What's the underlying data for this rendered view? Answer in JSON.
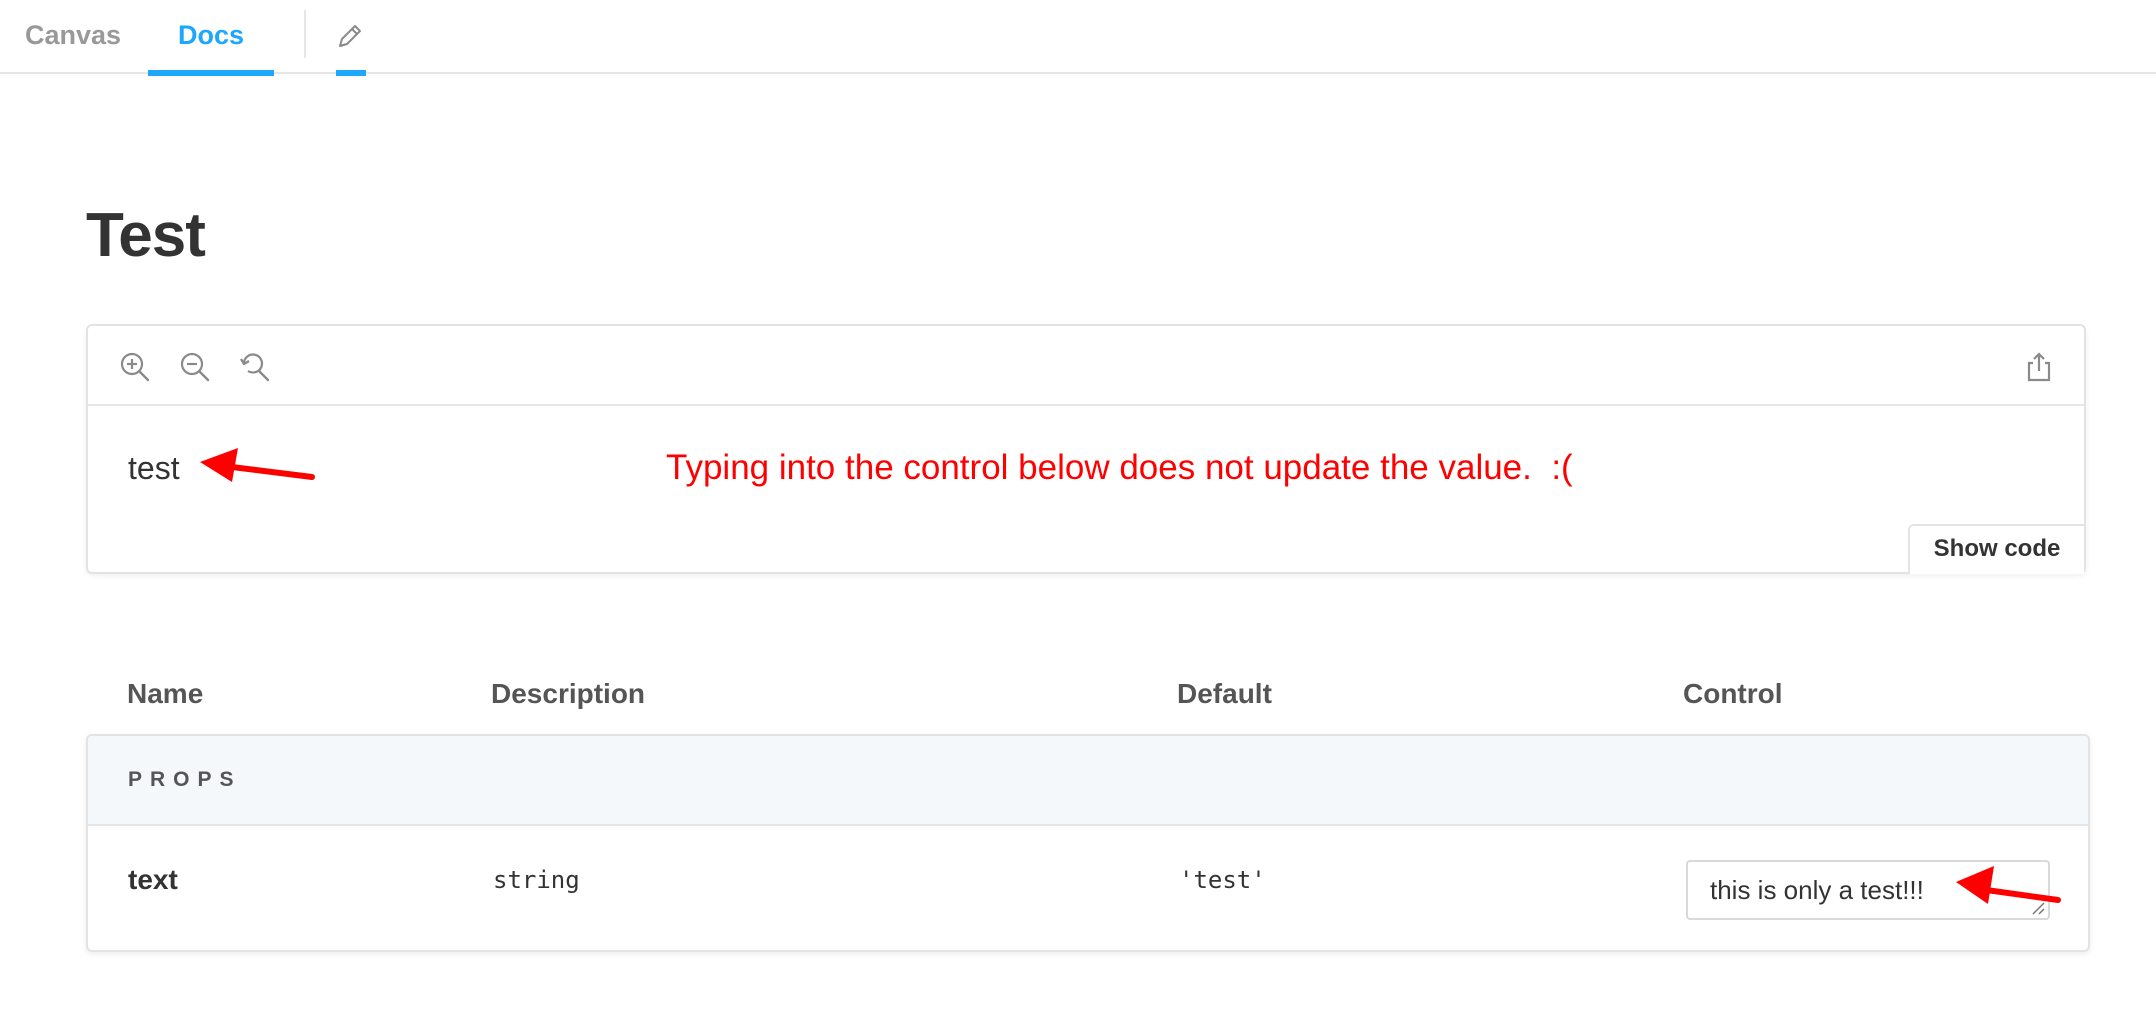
{
  "tabs": {
    "canvas": "Canvas",
    "docs": "Docs",
    "active": "docs"
  },
  "icons": {
    "pencil": "pencil-icon",
    "zoom_in": "zoom-in-icon",
    "zoom_out": "zoom-out-icon",
    "zoom_reset": "zoom-reset-icon",
    "share": "share-icon"
  },
  "colors": {
    "accent": "#1ea7fd",
    "annotation": "#ff0000"
  },
  "page": {
    "title": "Test"
  },
  "preview": {
    "rendered_text": "test",
    "annotation": "Typing into the control below does not update the value.  :(",
    "show_code_label": "Show code"
  },
  "args_table": {
    "headers": {
      "name": "Name",
      "description": "Description",
      "default": "Default",
      "control": "Control"
    },
    "section": "PROPS",
    "rows": [
      {
        "name": "text",
        "type": "string",
        "default": "'test'",
        "control_value": "this is only a test!!!"
      }
    ]
  }
}
